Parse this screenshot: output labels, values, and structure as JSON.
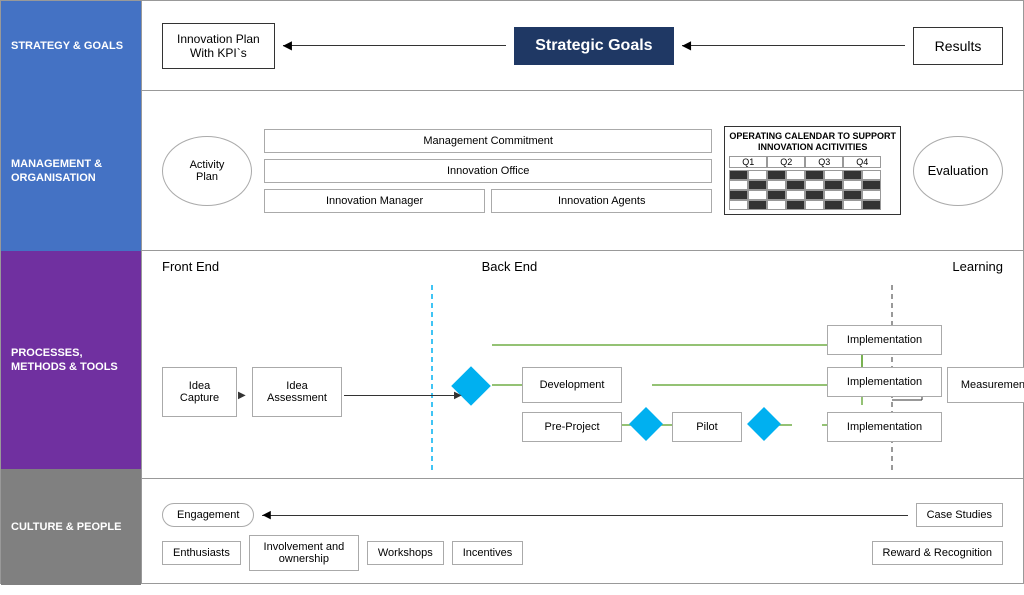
{
  "labels": {
    "strategy": "STRATEGY & GOALS",
    "management": "MANAGEMENT & ORGANISATION",
    "processes": "PROCESSES, METHODS & TOOLS",
    "culture": "CULTURE & PEOPLE"
  },
  "strategy": {
    "kpi_box": "Innovation Plan\nWith KPI`s",
    "strategic_goals": "Strategic Goals",
    "results": "Results"
  },
  "management": {
    "activity_plan": "Activity Plan",
    "management_commitment": "Management Commitment",
    "innovation_office": "Innovation Office",
    "innovation_manager": "Innovation Manager",
    "innovation_agents": "Innovation Agents",
    "calendar_title": "OPERATING CALENDAR TO SUPPORT\nINNOVATION ACITIVITIES",
    "q1": "Q1",
    "q2": "Q2",
    "q3": "Q3",
    "q4": "Q4",
    "evaluation": "Evaluation"
  },
  "processes": {
    "front_end": "Front End",
    "back_end": "Back End",
    "learning": "Learning",
    "idea_capture": "Idea Capture",
    "idea_assessment": "Idea Assessment",
    "development": "Development",
    "pre_project": "Pre-Project",
    "pilot": "Pilot",
    "impl1": "Implementation",
    "impl2": "Implementation",
    "impl3": "Implementation",
    "measurement": "Measurement"
  },
  "culture": {
    "engagement": "Engagement",
    "case_studies": "Case Studies",
    "enthusiasts": "Enthusiasts",
    "involvement": "Involvement and ownership",
    "workshops": "Workshops",
    "incentives": "Incentives",
    "reward": "Reward & Recognition"
  }
}
